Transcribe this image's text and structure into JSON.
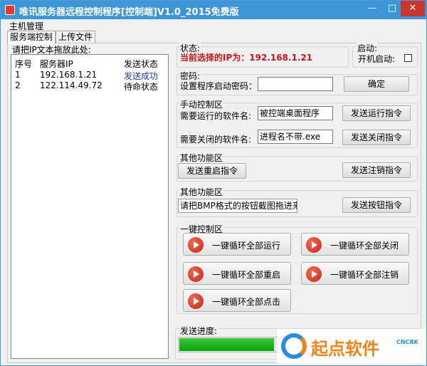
{
  "window": {
    "title": "唯讯服务器远程控制程序[控制端]V1.0_2015免费版",
    "minimize": "—",
    "maximize": "□",
    "close": "✕"
  },
  "menu": {
    "main": "主机管理"
  },
  "tabs": [
    {
      "label": "服务端控制",
      "active": true
    },
    {
      "label": "上传文件",
      "active": false
    }
  ],
  "left": {
    "drop_hint": "请把IP文本拖放此处:",
    "columns": [
      "序号",
      "服务器IP",
      "发送状态"
    ],
    "rows": [
      {
        "no": "1",
        "ip": "192.168.1.21",
        "status": "发送成功"
      },
      {
        "no": "2",
        "ip": "122.114.49.72",
        "status": "待命状态"
      }
    ]
  },
  "status": {
    "label": "状态:",
    "current_ip_text": "当前选择的IP为：192.168.1.21"
  },
  "startup": {
    "label": "启动:",
    "boot_label": "开机启动:",
    "checked": false
  },
  "password": {
    "group_label": "密码:",
    "field_label": "设置程序启动密码：",
    "value": "",
    "confirm": "确定"
  },
  "manual": {
    "group_label": "手动控制区",
    "run_label": "需要运行的软件名:",
    "run_value": "被控端桌面程序",
    "run_button": "发送运行指令",
    "close_label": "需要关闭的软件名:",
    "close_value": "进程名不带.exe",
    "close_button": "发送关闭指令"
  },
  "other1": {
    "group_label": "其他功能区",
    "restart_button": "发送重启指令",
    "logout_button": "发送注销指令"
  },
  "other2": {
    "group_label": "其他功能区",
    "bmp_hint": "请把BMP格式的按钮截图拖进来",
    "bmp_button": "发送按钮指令"
  },
  "oneclick": {
    "group_label": "一键控制区",
    "run_all": "一键循环全部运行",
    "close_all": "一键循环全部关闭",
    "restart_all": "一键循环全部重启",
    "logout_all": "一键循环全部注销",
    "click_all": "一键循环全部点击"
  },
  "progress": {
    "label": "发送进度:",
    "fraction": 0.4
  },
  "watermark": {
    "text": "起点软件",
    "sub": "CNCRK"
  },
  "colors": {
    "title_bar": "#3d96d6",
    "ip_red": "#c4161c",
    "success_blue": "#1c3fa8",
    "progress_green": "#06a806",
    "play_red": "#c4241a"
  },
  "icons": {
    "app": "app-icon",
    "play": "play-icon"
  }
}
